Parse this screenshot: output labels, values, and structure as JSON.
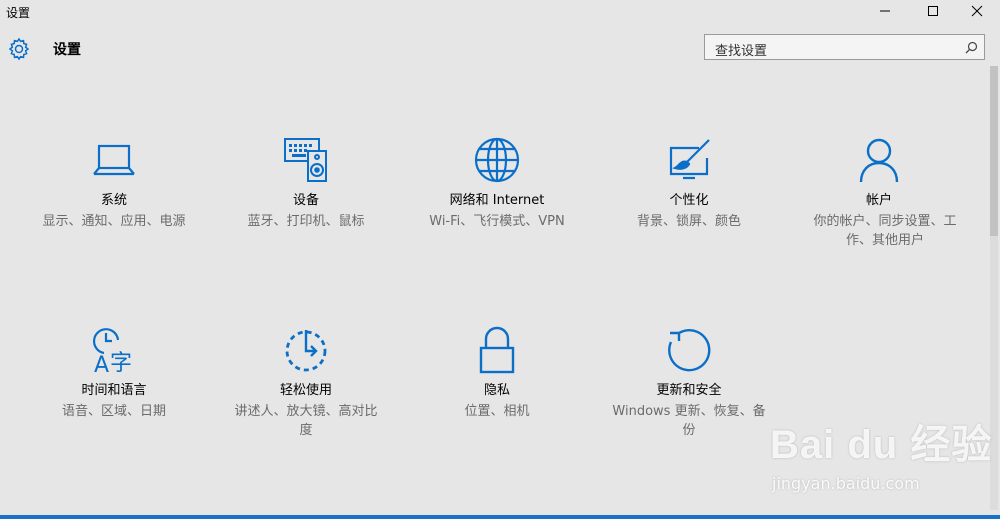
{
  "window": {
    "title": "设置"
  },
  "header": {
    "title": "设置"
  },
  "search": {
    "placeholder": "查找设置"
  },
  "accent_color": "#0b6fc9",
  "tiles": [
    {
      "icon": "laptop-icon",
      "name": "系统",
      "desc": "显示、通知、应用、电源"
    },
    {
      "icon": "devices-icon",
      "name": "设备",
      "desc": "蓝牙、打印机、鼠标"
    },
    {
      "icon": "globe-icon",
      "name": "网络和 Internet",
      "desc": "Wi-Fi、飞行模式、VPN"
    },
    {
      "icon": "personalization-icon",
      "name": "个性化",
      "desc": "背景、锁屏、颜色"
    },
    {
      "icon": "person-icon",
      "name": "帐户",
      "desc": "你的帐户、同步设置、工作、其他用户"
    },
    {
      "icon": "time-language-icon",
      "name": "时间和语言",
      "desc": "语音、区域、日期"
    },
    {
      "icon": "ease-of-access-icon",
      "name": "轻松使用",
      "desc": "讲述人、放大镜、高对比度"
    },
    {
      "icon": "lock-icon",
      "name": "隐私",
      "desc": "位置、相机"
    },
    {
      "icon": "update-icon",
      "name": "更新和安全",
      "desc": "Windows 更新、恢复、备份"
    }
  ],
  "watermark": {
    "logo": "Bai du 经验",
    "url": "jingyan.baidu.com"
  }
}
